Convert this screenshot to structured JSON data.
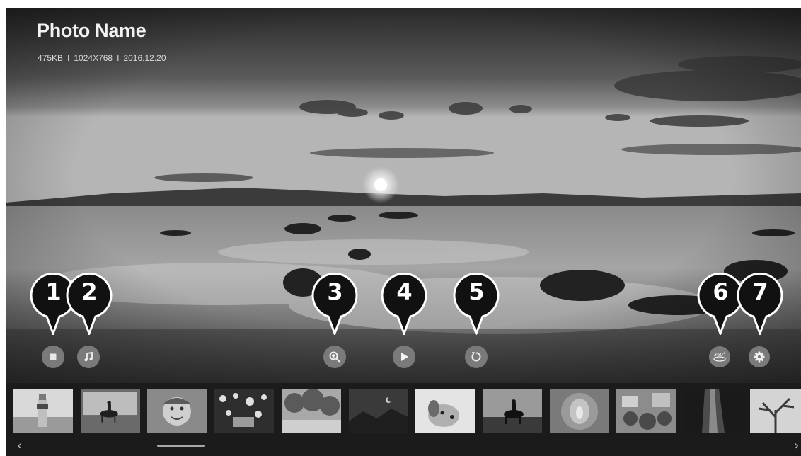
{
  "photo": {
    "name": "Photo Name",
    "size": "475KB",
    "resolution": "1024X768",
    "date": "2016.12.20",
    "separator": "I"
  },
  "controls": [
    {
      "id": "stop",
      "icon": "stop-icon",
      "callout": "1"
    },
    {
      "id": "music",
      "icon": "music-note-icon",
      "callout": "2"
    },
    {
      "id": "zoom",
      "icon": "zoom-in-icon",
      "callout": "3"
    },
    {
      "id": "play",
      "icon": "play-icon",
      "callout": "4"
    },
    {
      "id": "rotate",
      "icon": "rotate-icon",
      "callout": "5"
    },
    {
      "id": "view-360",
      "icon": "360-view-icon",
      "label": "360°",
      "callout": "6"
    },
    {
      "id": "settings",
      "icon": "gear-icon",
      "callout": "7"
    }
  ],
  "thumbnails": [
    {
      "subject": "lighthouse",
      "selected": false
    },
    {
      "subject": "horse-rider",
      "selected": true
    },
    {
      "subject": "child-face",
      "selected": false
    },
    {
      "subject": "flowers-wall",
      "selected": false
    },
    {
      "subject": "trees",
      "selected": false
    },
    {
      "subject": "moon-night",
      "selected": false
    },
    {
      "subject": "dog",
      "selected": false
    },
    {
      "subject": "horse-rider-dark",
      "selected": false
    },
    {
      "subject": "tunnel-leaves",
      "selected": false
    },
    {
      "subject": "garden-houses",
      "selected": false
    },
    {
      "subject": "waterfall-dark",
      "selected": false
    },
    {
      "subject": "tree-branches",
      "selected": false
    }
  ],
  "nav": {
    "left_icon": "chevron-left-icon",
    "left_glyph": "‹",
    "right_icon": "chevron-right-icon",
    "right_glyph": "›"
  },
  "colors": {
    "control_fill": "#7a7a7a",
    "callout_fill": "#111111",
    "selected_border": "#6a6a6a"
  }
}
